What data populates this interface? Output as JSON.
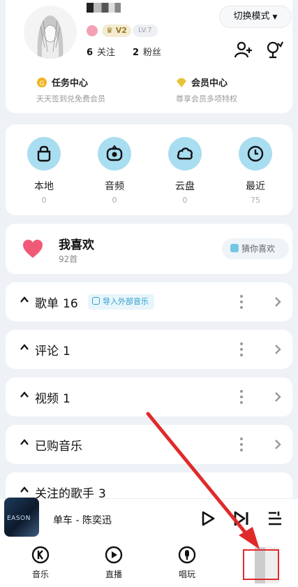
{
  "profile": {
    "vip_level": "2",
    "lv": "LV.7",
    "following_count": "6",
    "following_label": "关注",
    "fans_count": "2",
    "fans_label": "粉丝",
    "mode_switch": "切换模式",
    "task_center": {
      "title": "任务中心",
      "subtitle": "天天签到兑免费会员"
    },
    "member_center": {
      "title": "会员中心",
      "subtitle": "尊享会员多项特权"
    }
  },
  "quick_access": [
    {
      "label": "本地",
      "count": "0",
      "icon": "local-music-icon"
    },
    {
      "label": "音频",
      "count": "0",
      "icon": "audio-icon"
    },
    {
      "label": "云盘",
      "count": "0",
      "icon": "cloud-icon"
    },
    {
      "label": "最近",
      "count": "75",
      "icon": "clock-icon"
    }
  ],
  "favorites": {
    "title": "我喜欢",
    "count": "92首",
    "guess_button": "猜你喜欢"
  },
  "sections": [
    {
      "title": "歌单",
      "count": "16",
      "import_tag": "导入外部音乐"
    },
    {
      "title": "评论",
      "count": "1"
    },
    {
      "title": "视频",
      "count": "1"
    },
    {
      "title": "已购音乐",
      "count": ""
    },
    {
      "title": "关注的歌手",
      "count": "3"
    }
  ],
  "player": {
    "cover_text": "EASON",
    "song": "单车 - 陈奕迅"
  },
  "tabs": [
    {
      "label": "音乐",
      "icon": "music-k-icon"
    },
    {
      "label": "直播",
      "icon": "live-play-icon"
    },
    {
      "label": "唱玩",
      "icon": "mic-icon"
    }
  ],
  "colors": {
    "accent": "#a9ddf0",
    "heart": "#f05a78",
    "annotation": "#e02a2a",
    "vip_gold": "#c9a227"
  }
}
